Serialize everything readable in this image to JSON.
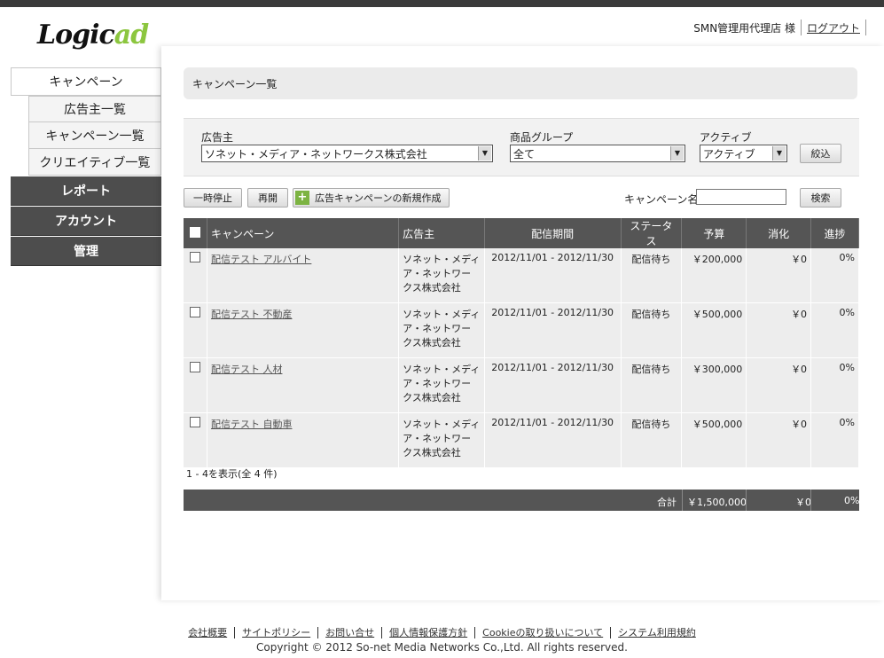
{
  "brand": {
    "logo_part1": "Logic",
    "logo_part2": "ad"
  },
  "header": {
    "user_name": "SMN管理用代理店 様",
    "logout_label": "ログアウト"
  },
  "sidebar": {
    "campaign": "キャンペーン",
    "sub": [
      "広告主一覧",
      "キャンペーン一覧",
      "クリエイティブ一覧"
    ],
    "report": "レポート",
    "account": "アカウント",
    "admin": "管理"
  },
  "page": {
    "title": "キャンペーン一覧"
  },
  "filters": {
    "advertiser_label": "広告主",
    "advertiser_value": "ソネット・メディア・ネットワークス株式会社",
    "group_label": "商品グループ",
    "group_value": "全て",
    "active_label": "アクティブ",
    "active_value": "アクティブ",
    "narrow_button": "絞込"
  },
  "toolbar": {
    "pause_button": "一時停止",
    "resume_button": "再開",
    "new_campaign_button": "広告キャンペーンの新規作成",
    "search_label": "キャンペーン名",
    "search_value": "",
    "search_button": "検索"
  },
  "table": {
    "headers": [
      "キャンペーン",
      "広告主",
      "配信期間",
      "ステータス",
      "予算",
      "消化",
      "進捗"
    ],
    "rows": [
      {
        "campaign": "配信テスト アルバイト",
        "advertiser": "ソネット・メディア・ネットワークス株式会社",
        "period": "2012/11/01 - 2012/11/30",
        "status": "配信待ち",
        "budget": "￥200,000",
        "spent": "￥0",
        "progress": "0%"
      },
      {
        "campaign": "配信テスト 不動産",
        "advertiser": "ソネット・メディア・ネットワークス株式会社",
        "period": "2012/11/01 - 2012/11/30",
        "status": "配信待ち",
        "budget": "￥500,000",
        "spent": "￥0",
        "progress": "0%"
      },
      {
        "campaign": "配信テスト 人材",
        "advertiser": "ソネット・メディア・ネットワークス株式会社",
        "period": "2012/11/01 - 2012/11/30",
        "status": "配信待ち",
        "budget": "￥300,000",
        "spent": "￥0",
        "progress": "0%"
      },
      {
        "campaign": "配信テスト 自動車",
        "advertiser": "ソネット・メディア・ネットワークス株式会社",
        "period": "2012/11/01 - 2012/11/30",
        "status": "配信待ち",
        "budget": "￥500,000",
        "spent": "￥0",
        "progress": "0%"
      }
    ],
    "count_text": "1 - 4を表示(全 4 件)"
  },
  "totals": {
    "label": "合計",
    "budget": "￥1,500,000",
    "spent": "￥0",
    "progress": "0%"
  },
  "footer": {
    "links": [
      "会社概要",
      "サイトポリシー",
      "お問い合せ",
      "個人情報保護方針",
      "Cookieの取り扱いについて",
      "システム利用規約"
    ],
    "copyright": "Copyright © 2012 So-net Media Networks Co.,Ltd. All rights reserved."
  }
}
